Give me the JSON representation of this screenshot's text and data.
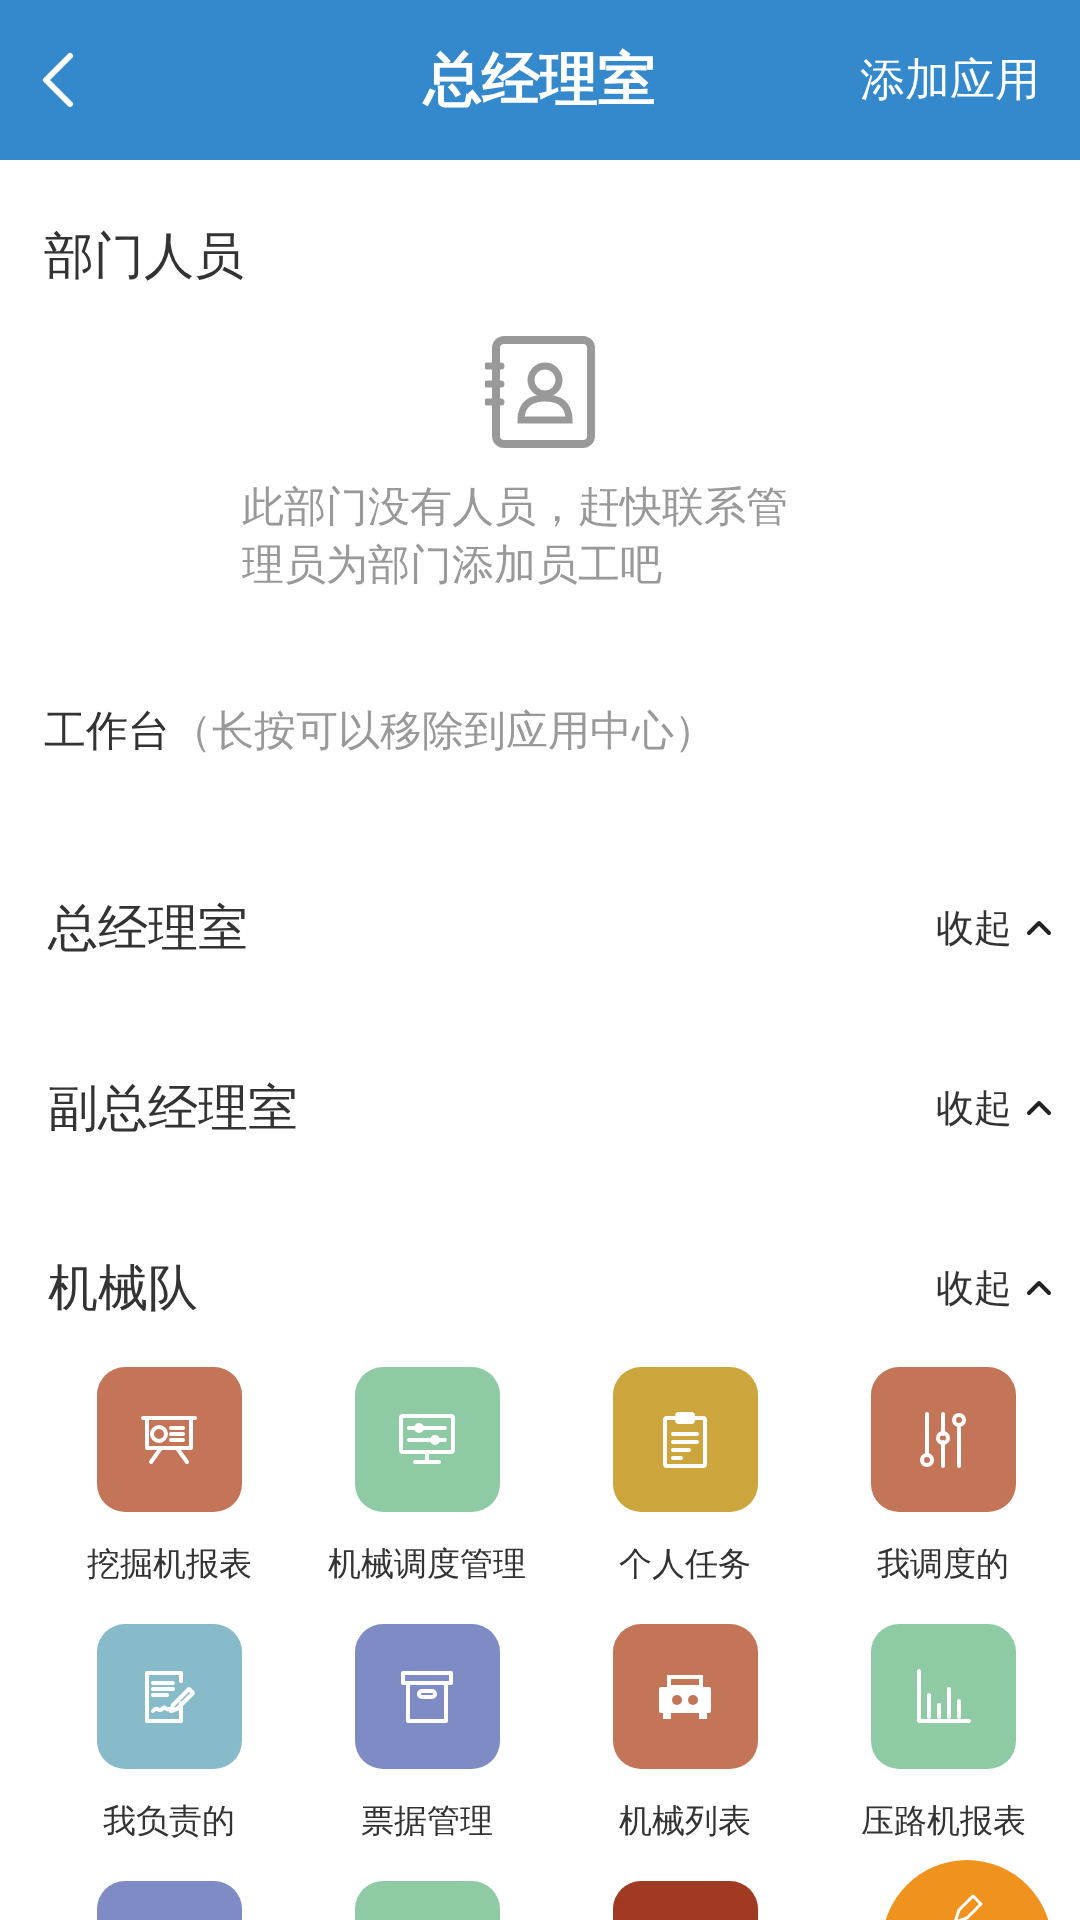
{
  "header": {
    "title": "总经理室",
    "action": "添加应用"
  },
  "members": {
    "title": "部门人员",
    "empty_message": "此部门没有人员，赶快联系管理员为部门添加员工吧"
  },
  "workbench": {
    "title": "工作台",
    "hint": "（长按可以移除到应用中心）"
  },
  "groups": [
    {
      "title": "总经理室",
      "toggle": "收起",
      "expanded": true
    },
    {
      "title": "副总经理室",
      "toggle": "收起",
      "expanded": true
    },
    {
      "title": "机械队",
      "toggle": "收起",
      "expanded": true,
      "apps": [
        {
          "label": "挖掘机报表",
          "kind": "presentation",
          "color": "#c47558"
        },
        {
          "label": "机械调度管理",
          "kind": "monitor",
          "color": "#8ecba4"
        },
        {
          "label": "个人任务",
          "kind": "clipboard",
          "color": "#cca63c"
        },
        {
          "label": "我调度的",
          "kind": "sliders",
          "color": "#c47558"
        },
        {
          "label": "我负责的",
          "kind": "sign",
          "color": "#87bbc9"
        },
        {
          "label": "票据管理",
          "kind": "archive",
          "color": "#7f8bc5"
        },
        {
          "label": "机械列表",
          "kind": "printer",
          "color": "#c47558"
        },
        {
          "label": "压路机报表",
          "kind": "chart",
          "color": "#8ecba4"
        },
        {
          "kind": "blank",
          "color": "#7f8bc5"
        },
        {
          "kind": "blank",
          "color": "#8ecba4"
        },
        {
          "kind": "blank",
          "color": "#a03a22"
        }
      ]
    }
  ]
}
